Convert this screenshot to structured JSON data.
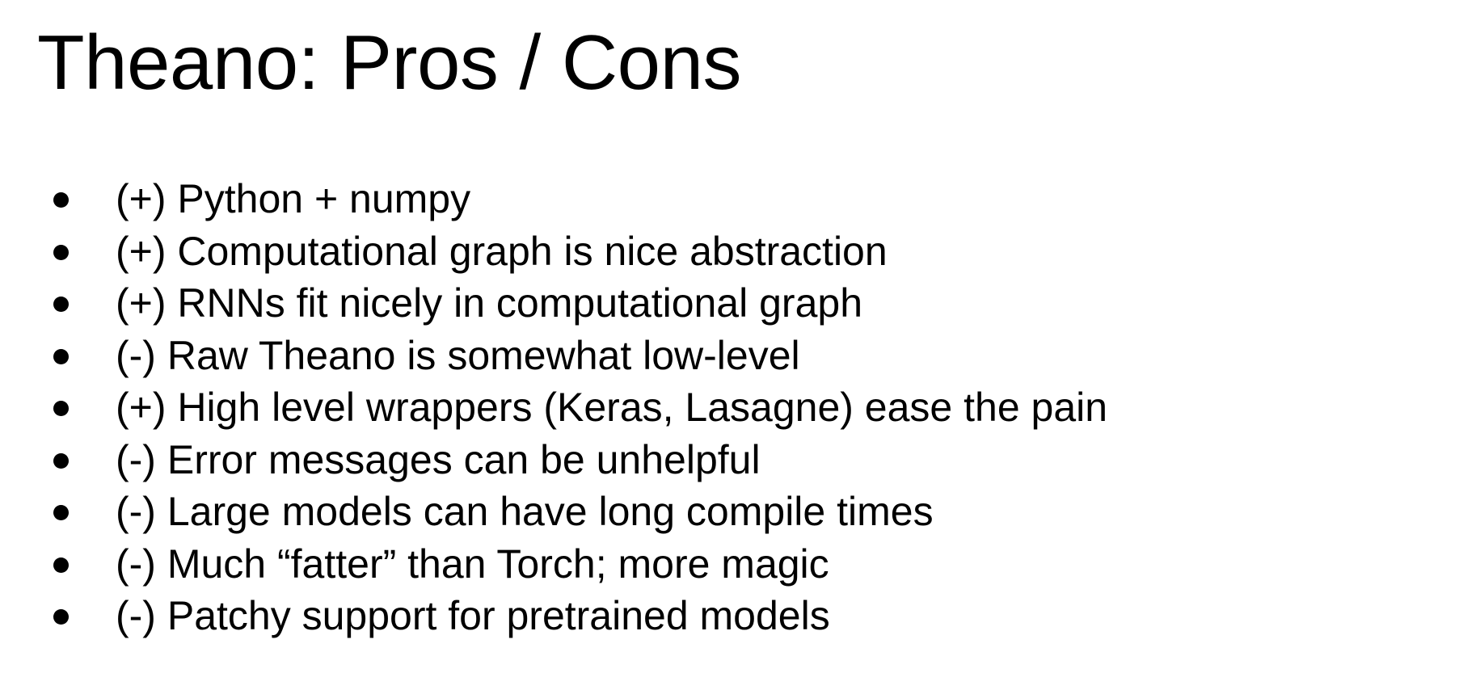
{
  "slide": {
    "title": "Theano: Pros / Cons",
    "bullets": [
      "(+) Python + numpy",
      "(+) Computational graph is nice abstraction",
      "(+) RNNs fit nicely in computational graph",
      "(-) Raw Theano is somewhat low-level",
      "(+) High level wrappers (Keras, Lasagne) ease the pain",
      "(-) Error messages can be unhelpful",
      "(-) Large models can have long compile times",
      "(-) Much “fatter” than Torch; more magic",
      "(-) Patchy support for pretrained models"
    ]
  }
}
